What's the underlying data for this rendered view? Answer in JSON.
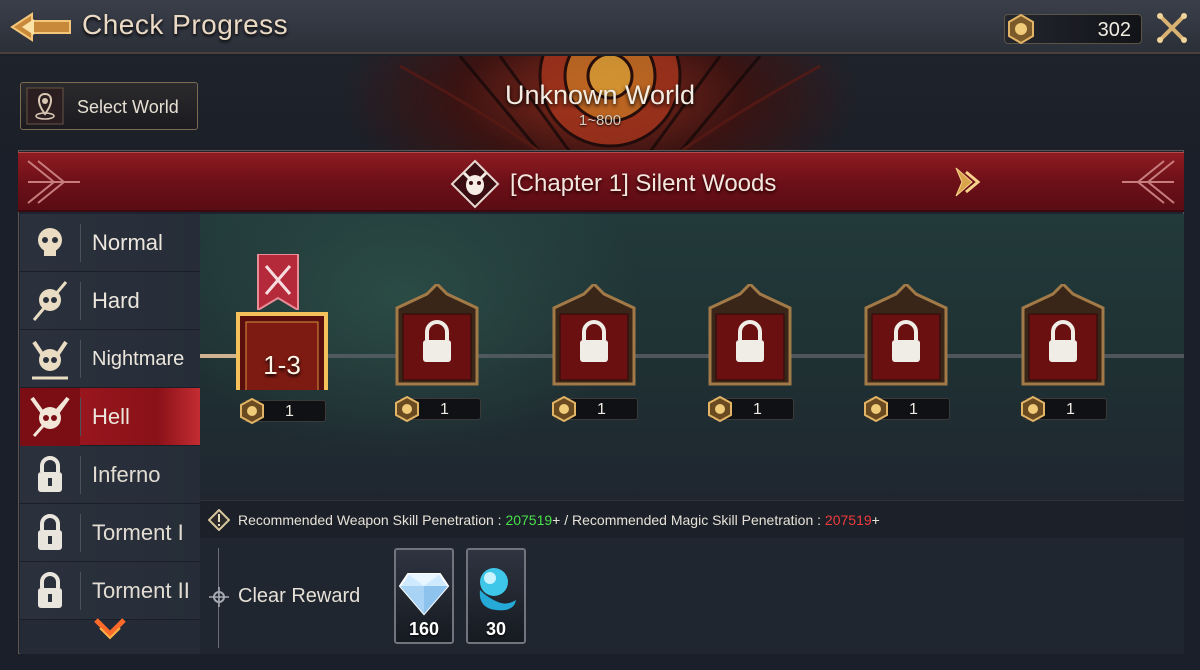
{
  "header": {
    "title": "Check Progress",
    "currency_value": "302"
  },
  "world": {
    "select_label": "Select World",
    "name": "Unknown World",
    "range": "1~800"
  },
  "chapter": {
    "title": "[Chapter 1] Silent Woods"
  },
  "difficulties": [
    {
      "label": "Normal",
      "icon": "skull-icon",
      "state": "unlocked"
    },
    {
      "label": "Hard",
      "icon": "skull-spear-icon",
      "state": "unlocked"
    },
    {
      "label": "Nightmare",
      "icon": "horned-skull-icon",
      "state": "unlocked"
    },
    {
      "label": "Hell",
      "icon": "demon-skull-icon",
      "state": "selected"
    },
    {
      "label": "Inferno",
      "icon": "lock-icon",
      "state": "locked"
    },
    {
      "label": "Torment I",
      "icon": "lock-icon",
      "state": "locked"
    },
    {
      "label": "Torment II",
      "icon": "lock-icon",
      "state": "locked"
    }
  ],
  "stages": [
    {
      "label": "1-3",
      "cost": "1",
      "state": "current"
    },
    {
      "label": "",
      "cost": "1",
      "state": "locked"
    },
    {
      "label": "",
      "cost": "1",
      "state": "locked"
    },
    {
      "label": "",
      "cost": "1",
      "state": "locked"
    },
    {
      "label": "",
      "cost": "1",
      "state": "locked"
    },
    {
      "label": "",
      "cost": "1",
      "state": "locked"
    }
  ],
  "recommendation": {
    "weapon_prefix": "Recommended Weapon Skill Penetration : ",
    "weapon_value": "207519",
    "weapon_suffix": "+ / Recommended Magic Skill Penetration : ",
    "magic_value": "207519",
    "magic_suffix": "+"
  },
  "reward": {
    "label": "Clear Reward",
    "items": [
      {
        "icon": "diamond-icon",
        "qty": "160"
      },
      {
        "icon": "blue-flame-orb-icon",
        "qty": "30"
      }
    ]
  },
  "colors": {
    "accent_red": "#8e1b22",
    "gold": "#d9a34a",
    "green_value": "#4ae04a",
    "red_value": "#ef3b3b"
  }
}
